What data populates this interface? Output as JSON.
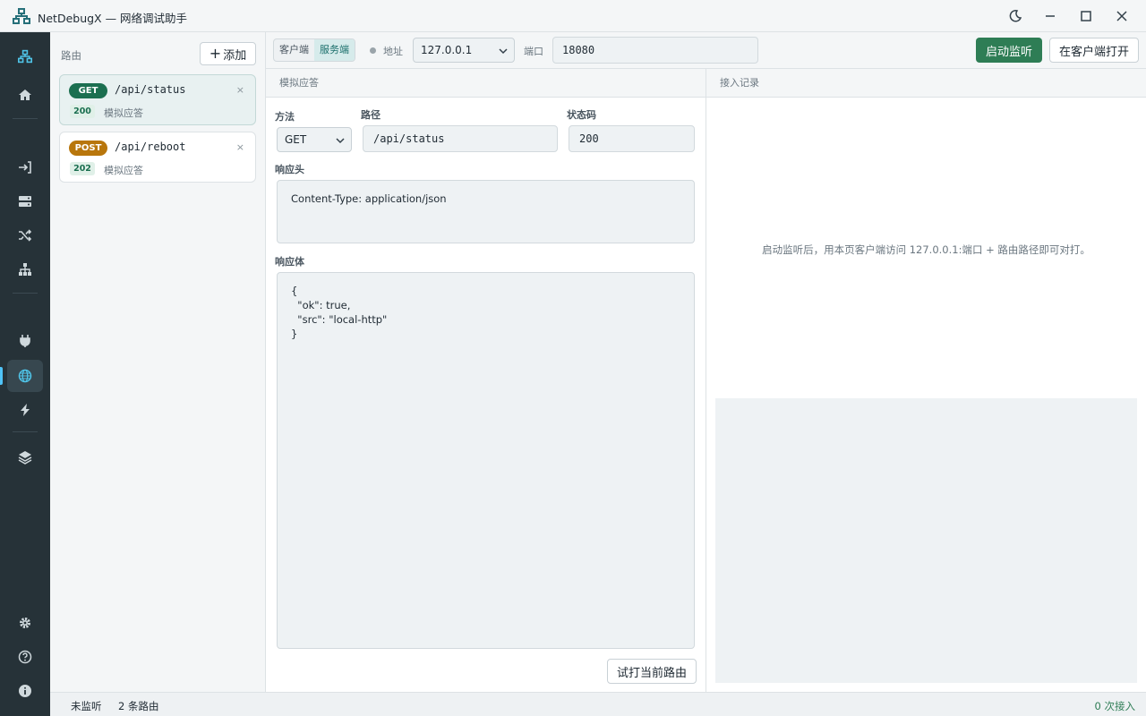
{
  "window": {
    "title": "NetDebugX — 网络调试助手",
    "icons": [
      "network-icon",
      "moon-icon",
      "minimize-icon",
      "maximize-icon",
      "close-icon"
    ]
  },
  "rail": {
    "items": [
      {
        "name": "home-icon"
      },
      {
        "name": "login-icon"
      },
      {
        "name": "server-icon"
      },
      {
        "name": "shuffle-icon"
      },
      {
        "name": "sitemap-icon"
      },
      {
        "name": "plug-icon"
      },
      {
        "name": "globe-icon",
        "active": true
      },
      {
        "name": "bolt-icon"
      },
      {
        "name": "layers-icon"
      },
      {
        "name": "gear-icon"
      },
      {
        "name": "help-icon"
      },
      {
        "name": "info-icon"
      }
    ]
  },
  "routes": {
    "title": "路由",
    "add_label": "添加",
    "add_symbol": "+",
    "items": [
      {
        "method": "GET",
        "path": "/api/status",
        "status": "200",
        "desc": "模拟应答",
        "close": "×"
      },
      {
        "method": "POST",
        "path": "/api/reboot",
        "status": "202",
        "desc": "模拟应答",
        "close": "×"
      }
    ]
  },
  "toolbar": {
    "mode_client": "客户端",
    "mode_server": "服务端",
    "addr_label": "地址",
    "addr_value": "127.0.0.1",
    "port_label": "端口",
    "port_value": "18080",
    "start_label": "启动监听",
    "open_client_label": "在客户端打开"
  },
  "mock": {
    "title": "模拟应答",
    "method_label": "方法",
    "method_value": "GET",
    "path_label": "路径",
    "path_value": "/api/status",
    "status_label": "状态码",
    "status_value": "200",
    "headers_label": "响应头",
    "headers_value": "Content-Type: application/json",
    "body_label": "响应体",
    "body_value": "{\n  \"ok\": true,\n  \"src\": \"local-http\"\n}",
    "try_label": "试打当前路由"
  },
  "log": {
    "title": "接入记录",
    "hint": "启动监听后，用本页客户端访问 127.0.0.1:端口 + 路由路径即可对打。"
  },
  "status": {
    "listen": "未监听",
    "routes": "2 条路由",
    "connections": "0 次接入"
  },
  "colors": {
    "accent": "#2e7d55",
    "get_badge": "#1b6f50",
    "post_badge": "#b8760c",
    "rail_bg": "#263238"
  }
}
